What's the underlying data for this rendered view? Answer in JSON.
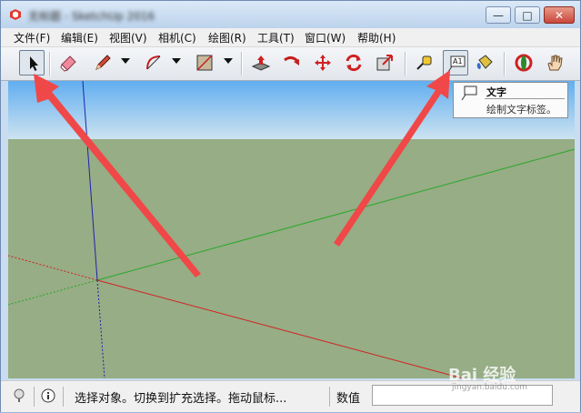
{
  "window": {
    "title": "无标题 - SketchUp 2016",
    "buttons": {
      "minimize": "—",
      "maximize": "□",
      "close": "✕"
    }
  },
  "menu": [
    "文件(F)",
    "编辑(E)",
    "视图(V)",
    "相机(C)",
    "绘图(R)",
    "工具(T)",
    "窗口(W)",
    "帮助(H)"
  ],
  "toolbar": {
    "tools": [
      "select-icon",
      "eraser-icon",
      "pencil-line-icon",
      "arc-icon",
      "rectangle-icon",
      "push-pull-icon",
      "follow-me-icon",
      "move-icon",
      "rotate-icon",
      "scale-icon",
      "tape-measure-icon",
      "text-icon",
      "paint-bucket-icon",
      "orbit-icon",
      "pan-icon"
    ],
    "text_tool_label": "A1"
  },
  "tooltip": {
    "title": "文字",
    "description": "绘制文字标签。"
  },
  "status": {
    "text": "选择对象。切换到扩充选择。拖动鼠标...",
    "value_label": "数值",
    "value": ""
  },
  "watermark": {
    "main": "Bai 经验",
    "sub": "jingyan.baidu.com"
  },
  "colors": {
    "sky_top": "#61aef0",
    "ground": "#96ad85",
    "axis_red": "#d42020",
    "axis_green": "#28a828",
    "axis_blue": "#2020b0",
    "arrow": "#f04848"
  }
}
